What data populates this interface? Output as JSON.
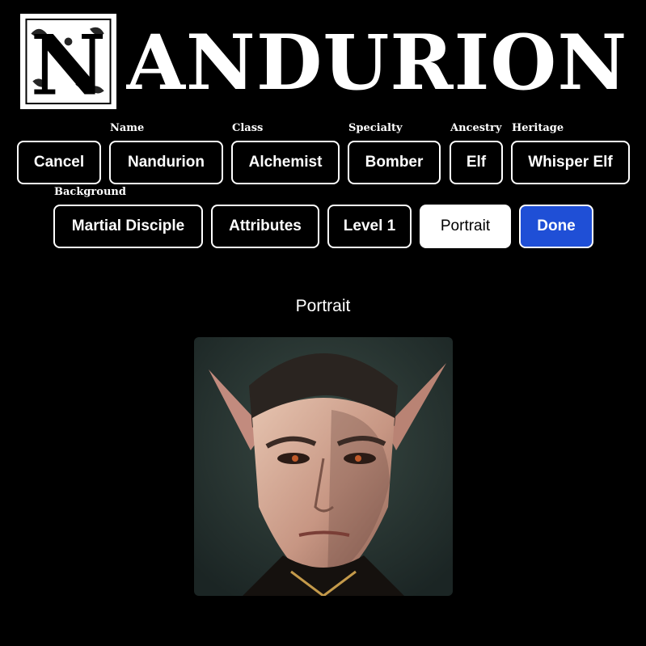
{
  "header": {
    "logo_initial": "N",
    "logo_rest": "ANDURION"
  },
  "row1": {
    "cancel": "Cancel",
    "name": {
      "label": "Name",
      "value": "Nandurion"
    },
    "class": {
      "label": "Class",
      "value": "Alchemist"
    },
    "specialty": {
      "label": "Specialty",
      "value": "Bomber"
    },
    "ancestry": {
      "label": "Ancestry",
      "value": "Elf"
    },
    "heritage": {
      "label": "Heritage",
      "value": "Whisper Elf"
    }
  },
  "row2": {
    "background": {
      "label": "Background",
      "value": "Martial Disciple"
    },
    "attributes": "Attributes",
    "level": "Level 1",
    "portrait": "Portrait",
    "done": "Done"
  },
  "main": {
    "section_title": "Portrait"
  },
  "colors": {
    "background": "#000000",
    "primary": "#1f4fd6",
    "active_bg": "#ffffff"
  }
}
